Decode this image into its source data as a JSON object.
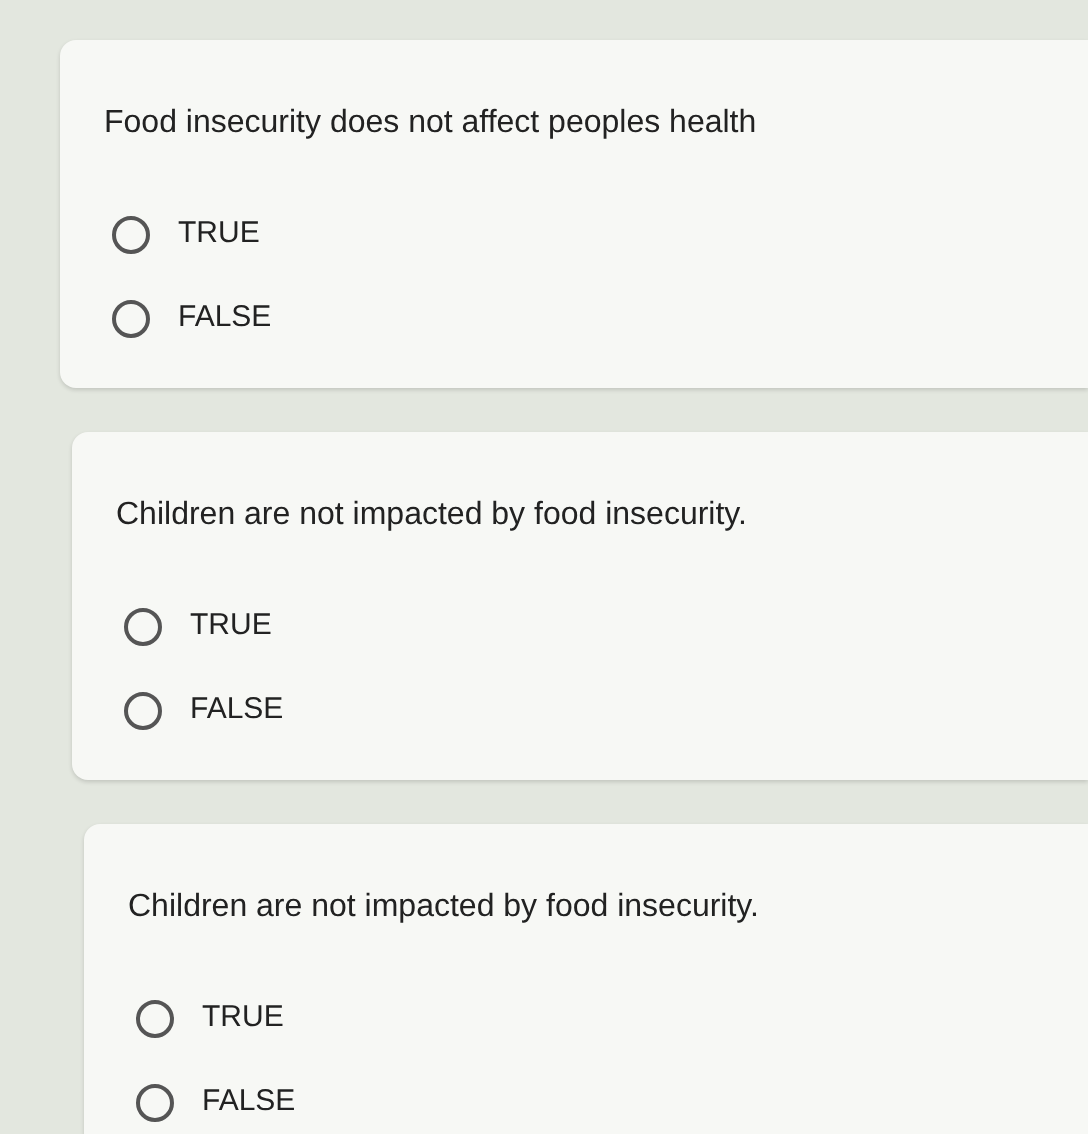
{
  "questions": [
    {
      "text": "Food insecurity does not affect peoples health",
      "options": [
        {
          "label": "TRUE",
          "selected": false
        },
        {
          "label": "FALSE",
          "selected": false
        }
      ]
    },
    {
      "text": "Children are not impacted by food insecurity.",
      "options": [
        {
          "label": "TRUE",
          "selected": false
        },
        {
          "label": "FALSE",
          "selected": false
        }
      ]
    },
    {
      "text": "Children are not impacted by food insecurity.",
      "options": [
        {
          "label": "TRUE",
          "selected": false
        },
        {
          "label": "FALSE",
          "selected": false
        }
      ]
    }
  ]
}
